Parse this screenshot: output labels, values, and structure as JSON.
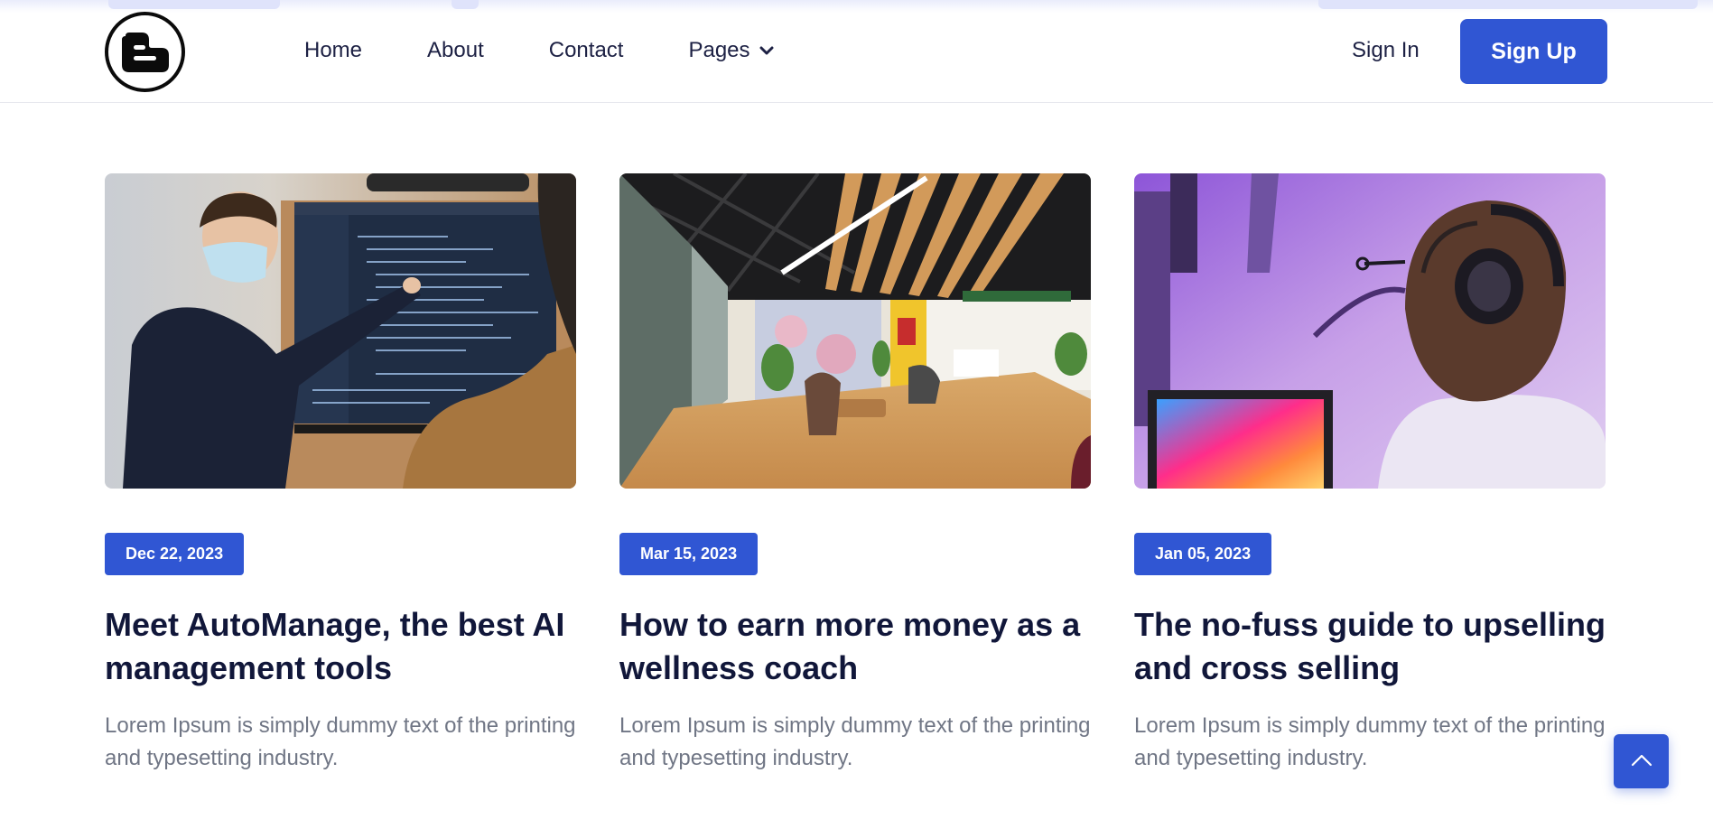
{
  "header": {
    "logo_icon": "blogger-b-logo-icon",
    "nav": [
      {
        "label": "Home"
      },
      {
        "label": "About"
      },
      {
        "label": "Contact"
      },
      {
        "label": "Pages",
        "icon": "chevron-down-icon"
      }
    ],
    "sign_in_label": "Sign In",
    "sign_up_label": "Sign Up"
  },
  "colors": {
    "accent": "#3056d3",
    "heading": "#11173a",
    "body_text": "#707685",
    "nav_text": "#1d2144"
  },
  "posts": [
    {
      "date": "Dec 22, 2023",
      "title": "Meet AutoManage, the best AI management tools",
      "description": "Lorem Ipsum is simply dummy text of the printing and typesetting industry.",
      "image": "person-presenting-code-screen-photo"
    },
    {
      "date": "Mar 15, 2023",
      "title": "How to earn more money as a wellness coach",
      "description": "Lorem Ipsum is simply dummy text of the printing and typesetting industry.",
      "image": "office-lounge-interior-photo"
    },
    {
      "date": "Jan 05, 2023",
      "title": "The no-fuss guide to upselling and cross selling",
      "description": "Lorem Ipsum is simply dummy text of the printing and typesetting industry.",
      "image": "man-with-headphones-at-laptop-photo"
    }
  ],
  "back_to_top_icon": "chevron-up-icon"
}
